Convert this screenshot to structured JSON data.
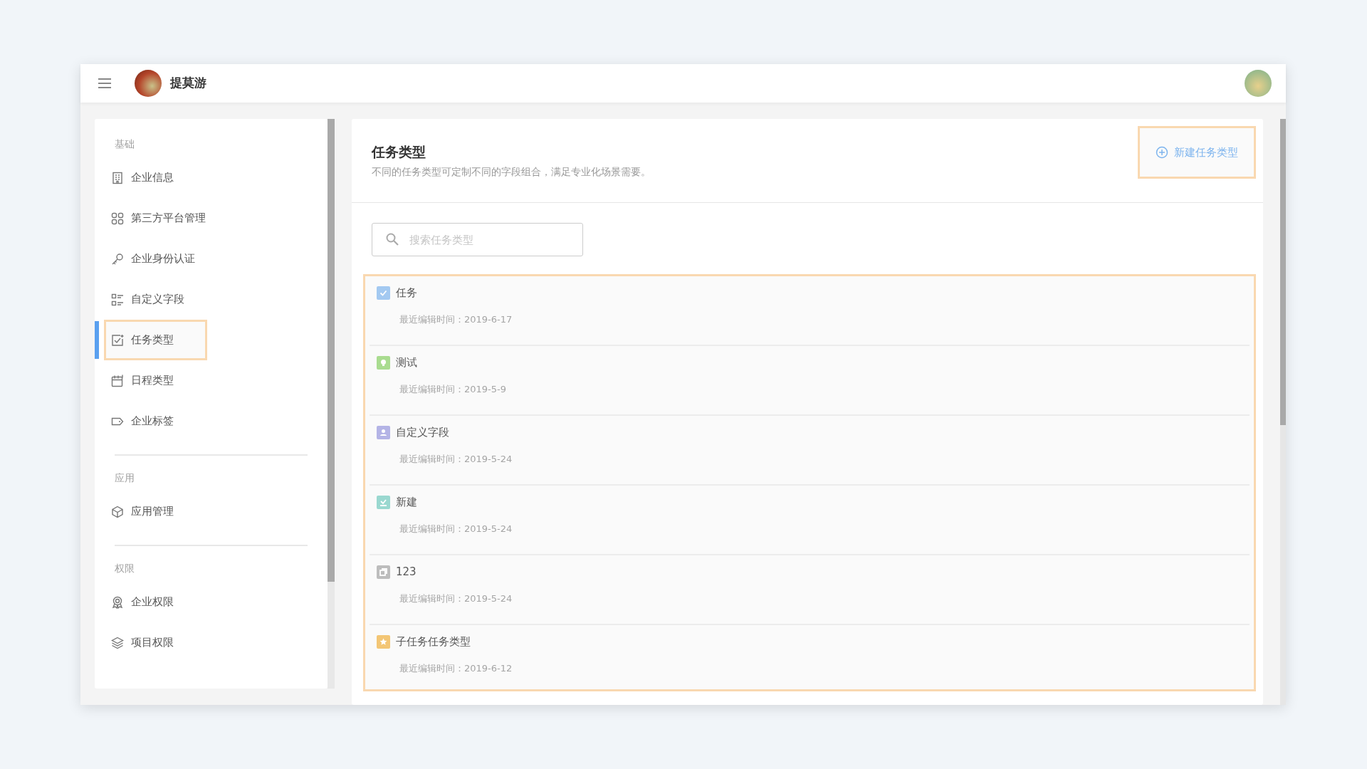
{
  "header": {
    "brand": "提莫游"
  },
  "sidebar": {
    "sections": [
      {
        "label": "基础",
        "items": [
          {
            "label": "企业信息",
            "kind": "building",
            "selected": false
          },
          {
            "label": "第三方平台管理",
            "kind": "grid",
            "selected": false
          },
          {
            "label": "企业身份认证",
            "kind": "key",
            "selected": false
          },
          {
            "label": "自定义字段",
            "kind": "list",
            "selected": false
          },
          {
            "label": "任务类型",
            "kind": "task",
            "selected": true
          },
          {
            "label": "日程类型",
            "kind": "calendar",
            "selected": false
          },
          {
            "label": "企业标签",
            "kind": "tag",
            "selected": false
          }
        ]
      },
      {
        "label": "应用",
        "items": [
          {
            "label": "应用管理",
            "kind": "cube",
            "selected": false
          }
        ]
      },
      {
        "label": "权限",
        "items": [
          {
            "label": "企业权限",
            "kind": "badge",
            "selected": false
          },
          {
            "label": "项目权限",
            "kind": "layers",
            "selected": false
          }
        ]
      }
    ]
  },
  "main": {
    "title": "任务类型",
    "subtitle": "不同的任务类型可定制不同的字段组合，满足专业化场景需要。",
    "new_button": "新建任务类型",
    "search": {
      "placeholder": "搜索任务类型"
    },
    "task_types": [
      {
        "name": "任务",
        "edited": "最近编辑时间：2019-6-17",
        "kind": "check",
        "color": "#a3c9f1"
      },
      {
        "name": "测试",
        "edited": "最近编辑时间：2019-5-9",
        "kind": "bulb",
        "color": "#a9dc90"
      },
      {
        "name": "自定义字段",
        "edited": "最近编辑时间：2019-5-24",
        "kind": "person",
        "color": "#b4b4e6"
      },
      {
        "name": "新建",
        "edited": "最近编辑时间：2019-5-24",
        "kind": "inbox",
        "color": "#9ad8d0"
      },
      {
        "name": "123",
        "edited": "最近编辑时间：2019-5-24",
        "kind": "copy",
        "color": "#bdbdbd"
      },
      {
        "name": "子任务任务类型",
        "edited": "最近编辑时间：2019-6-12",
        "kind": "star",
        "color": "#f3c675"
      }
    ]
  }
}
